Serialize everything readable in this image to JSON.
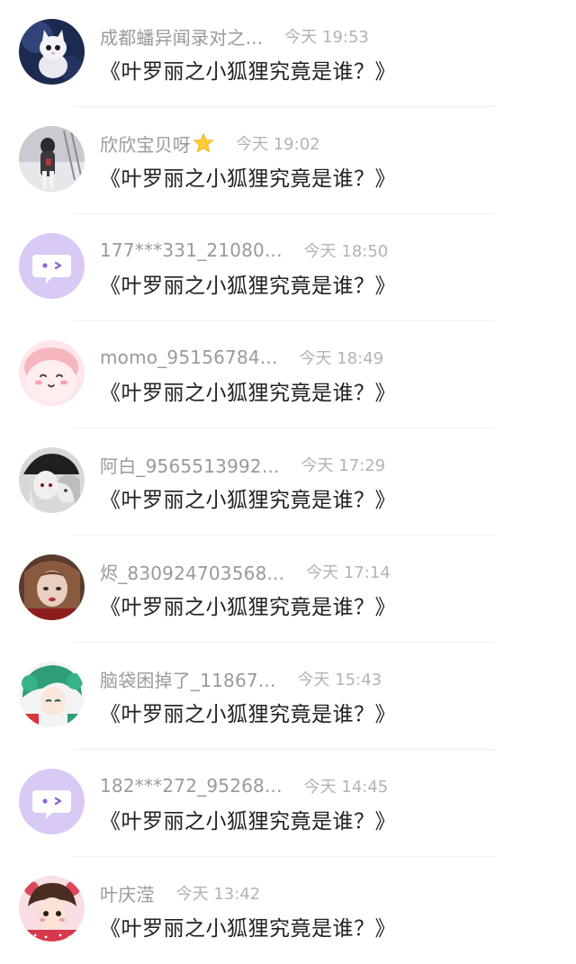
{
  "messages": [
    {
      "name": "成都蟠异闻录对之...",
      "time": "今天 19:53",
      "text": "《叶罗丽之小狐狸究竟是谁？》",
      "avatar": "cat-photo-avatar"
    },
    {
      "name": "欣欣宝贝呀",
      "time": "今天 19:02",
      "text": "《叶罗丽之小狐狸究竟是谁？》",
      "avatar": "snow-photo-avatar",
      "badge": "star-icon"
    },
    {
      "name": "177***331_21080...",
      "time": "今天 18:50",
      "text": "《叶罗丽之小狐狸究竟是谁？》",
      "avatar": "default-chat-avatar"
    },
    {
      "name": "momo_95156784...",
      "time": "今天 18:49",
      "text": "《叶罗丽之小狐狸究竟是谁？》",
      "avatar": "pink-cartoon-avatar"
    },
    {
      "name": "阿白_9565513992...",
      "time": "今天 17:29",
      "text": "《叶罗丽之小狐狸究竟是谁？》",
      "avatar": "anime-girls-avatar"
    },
    {
      "name": "烬_830924703568...",
      "time": "今天 17:14",
      "text": "《叶罗丽之小狐狸究竟是谁？》",
      "avatar": "doll-portrait-avatar"
    },
    {
      "name": "脑袋困掉了_11867...",
      "time": "今天 15:43",
      "text": "《叶罗丽之小狐狸究竟是谁？》",
      "avatar": "green-hair-anime-avatar"
    },
    {
      "name": "182***272_95268...",
      "time": "今天 14:45",
      "text": "《叶罗丽之小狐狸究竟是谁？》",
      "avatar": "default-chat-avatar"
    },
    {
      "name": "叶庆滢",
      "time": "今天 13:42",
      "text": "《叶罗丽之小狐狸究竟是谁？》",
      "avatar": "strawberry-girl-avatar"
    }
  ],
  "colors": {
    "name_text": "#9a9a9a",
    "time_text": "#b3b3b3",
    "message_text": "#222222",
    "divider": "#f0f0f0",
    "default_avatar_bg": "#d9c9f5"
  }
}
